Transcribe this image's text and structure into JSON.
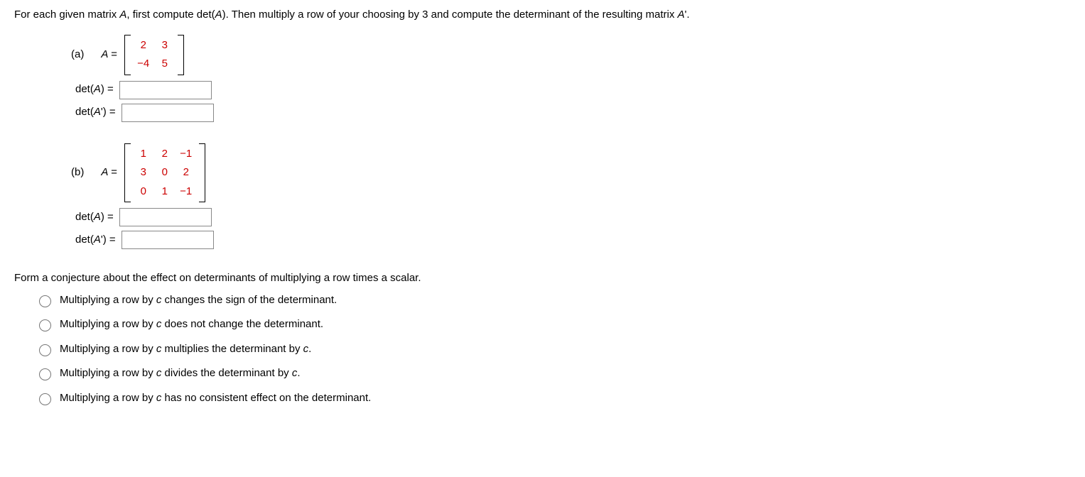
{
  "instructions": "For each given matrix A, first compute det(A). Then multiply a row of your choosing by 3 and compute the determinant of the resulting matrix A'.",
  "partA": {
    "label": "(a)",
    "matrixLabel": "A =",
    "matrix": [
      [
        "2",
        "3"
      ],
      [
        "−4",
        "5"
      ]
    ],
    "detA_label": "det(A) =",
    "detA_value": "",
    "detAp_label": "det(A') =",
    "detAp_value": ""
  },
  "partB": {
    "label": "(b)",
    "matrixLabel": "A =",
    "matrix": [
      [
        "1",
        "2",
        "−1"
      ],
      [
        "3",
        "0",
        "2"
      ],
      [
        "0",
        "1",
        "−1"
      ]
    ],
    "detA_label": "det(A) =",
    "detA_value": "",
    "detAp_label": "det(A') =",
    "detAp_value": ""
  },
  "conjecture_prompt": "Form a conjecture about the effect on determinants of multiplying a row times a scalar.",
  "options": [
    "Multiplying a row by c changes the sign of the determinant.",
    "Multiplying a row by c does not change the determinant.",
    "Multiplying a row by c multiplies the determinant by c.",
    "Multiplying a row by c divides the determinant by c.",
    "Multiplying a row by c has no consistent effect on the determinant."
  ]
}
